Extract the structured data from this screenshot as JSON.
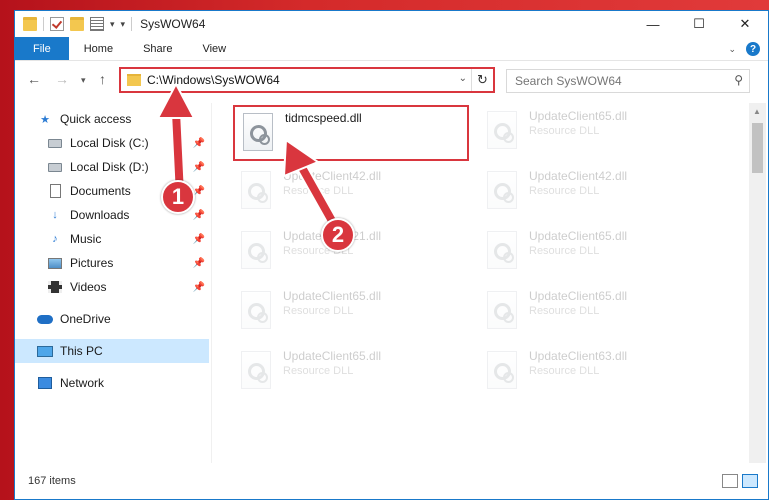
{
  "window": {
    "title": "SysWOW64"
  },
  "ribbon": {
    "tabs": [
      {
        "label": "File"
      },
      {
        "label": "Home"
      },
      {
        "label": "Share"
      },
      {
        "label": "View"
      }
    ]
  },
  "address": {
    "path": "C:\\Windows\\SysWOW64"
  },
  "search": {
    "placeholder": "Search SysWOW64"
  },
  "nav": {
    "items": [
      {
        "label": "Quick access",
        "icon": "star-icon"
      },
      {
        "label": "Local Disk (C:)",
        "icon": "disk-icon",
        "pinned": true
      },
      {
        "label": "Local Disk (D:)",
        "icon": "disk-icon",
        "pinned": true
      },
      {
        "label": "Documents",
        "icon": "documents-icon",
        "pinned": true
      },
      {
        "label": "Downloads",
        "icon": "download-icon",
        "pinned": true
      },
      {
        "label": "Music",
        "icon": "music-icon",
        "pinned": true
      },
      {
        "label": "Pictures",
        "icon": "pictures-icon",
        "pinned": true
      },
      {
        "label": "Videos",
        "icon": "videos-icon",
        "pinned": true
      },
      {
        "label": "OneDrive",
        "icon": "cloud-icon"
      },
      {
        "label": "This PC",
        "icon": "computer-icon",
        "selected": true
      },
      {
        "label": "Network",
        "icon": "network-icon"
      }
    ]
  },
  "files": [
    {
      "name": "tidmcspeed.dll",
      "type": "",
      "highlighted": true
    },
    {
      "name": "UpdateClient65.dll",
      "type": "Resource DLL"
    },
    {
      "name": "UpdateClient42.dll",
      "type": "Resource DLL"
    },
    {
      "name": "UpdateClient42.dll",
      "type": "Resource DLL"
    },
    {
      "name": "UpdateClient21.dll",
      "type": "Resource DLL"
    },
    {
      "name": "UpdateClient65.dll",
      "type": "Resource DLL"
    },
    {
      "name": "UpdateClient65.dll",
      "type": "Resource DLL"
    },
    {
      "name": "UpdateClient65.dll",
      "type": "Resource DLL"
    },
    {
      "name": "UpdateClient65.dll",
      "type": "Resource DLL"
    },
    {
      "name": "UpdateClient63.dll",
      "type": "Resource DLL"
    }
  ],
  "status": {
    "item_count": "167 items"
  },
  "annotations": {
    "step1": "1",
    "step2": "2",
    "color": "#d9363e"
  },
  "colors": {
    "accent": "#1979ca",
    "annotation": "#d9363e",
    "selected": "#cce8ff"
  }
}
